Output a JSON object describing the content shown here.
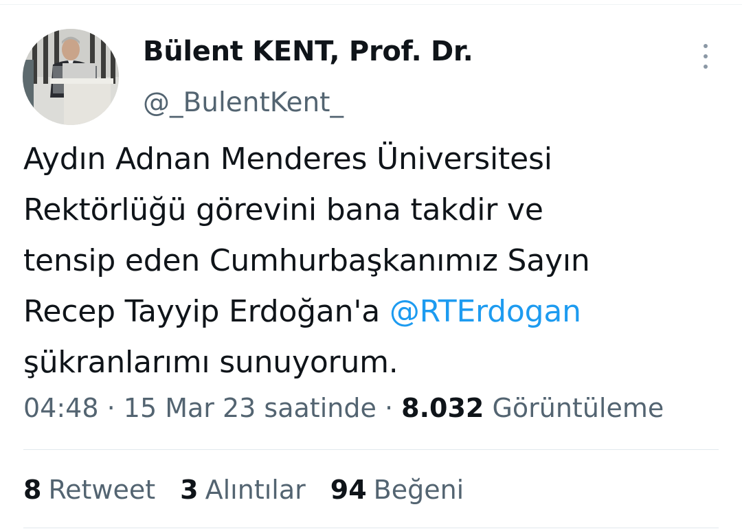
{
  "tweet": {
    "author": {
      "display_name": "Bülent KENT, Prof. Dr.",
      "handle": "@_BulentKent_"
    },
    "text_lines": [
      "Aydın Adnan Menderes Üniversitesi",
      "Rektörlüğü görevini bana takdir ve",
      "tensip eden Cumhurbaşkanımız Sayın",
      "Recep Tayyip Erdoğan'a "
    ],
    "mention": "@RTErdogan",
    "text_last_line": "şükranlarımı sunuyorum.",
    "meta": {
      "time": "04:48",
      "separator": "·",
      "date": "15 Mar 23 saatinde",
      "views_count": "8.032",
      "views_label": "Görüntüleme"
    },
    "stats": {
      "retweets_count": "8",
      "retweets_label": "Retweet",
      "quotes_count": "3",
      "quotes_label": "Alıntılar",
      "likes_count": "94",
      "likes_label": "Beğeni"
    }
  },
  "colors": {
    "text": "#0f1419",
    "secondary": "#536471",
    "link": "#1d9bf0",
    "divider": "#e1e8ed"
  },
  "icons": [
    "more-icon"
  ]
}
